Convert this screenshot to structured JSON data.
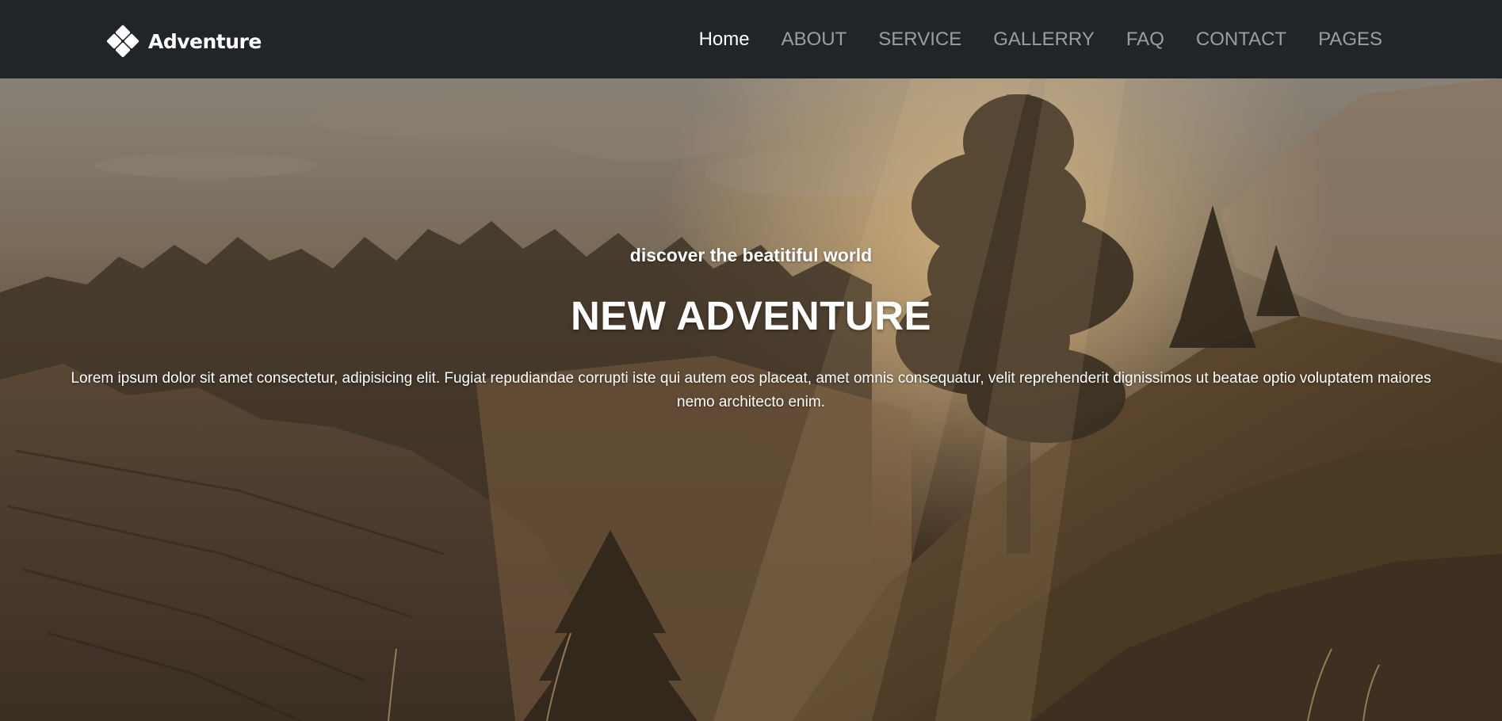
{
  "brand": {
    "name": "Adventure",
    "logo_icon": "four-diamond-logo-icon"
  },
  "nav": {
    "items": [
      {
        "label": "Home",
        "active": true
      },
      {
        "label": "ABOUT",
        "active": false
      },
      {
        "label": "SERVICE",
        "active": false
      },
      {
        "label": "GALLERRY",
        "active": false
      },
      {
        "label": "FAQ",
        "active": false
      },
      {
        "label": "CONTACT",
        "active": false
      },
      {
        "label": "PAGES",
        "active": false
      }
    ]
  },
  "hero": {
    "subtitle": "discover the beatitiful world",
    "title": "NEW ADVENTURE",
    "text": "Lorem ipsum dolor sit amet consectetur, adipisicing elit. Fugiat repudiandae corrupti iste qui autem eos placeat, amet omnis consequatur, velit reprehenderit dignissimos ut beatae optio voluptatem maiores nemo architecto enim."
  },
  "colors": {
    "navbar_bg": "#212529",
    "nav_active": "#ffffff",
    "nav_inactive": "rgba(255,255,255,0.55)"
  }
}
